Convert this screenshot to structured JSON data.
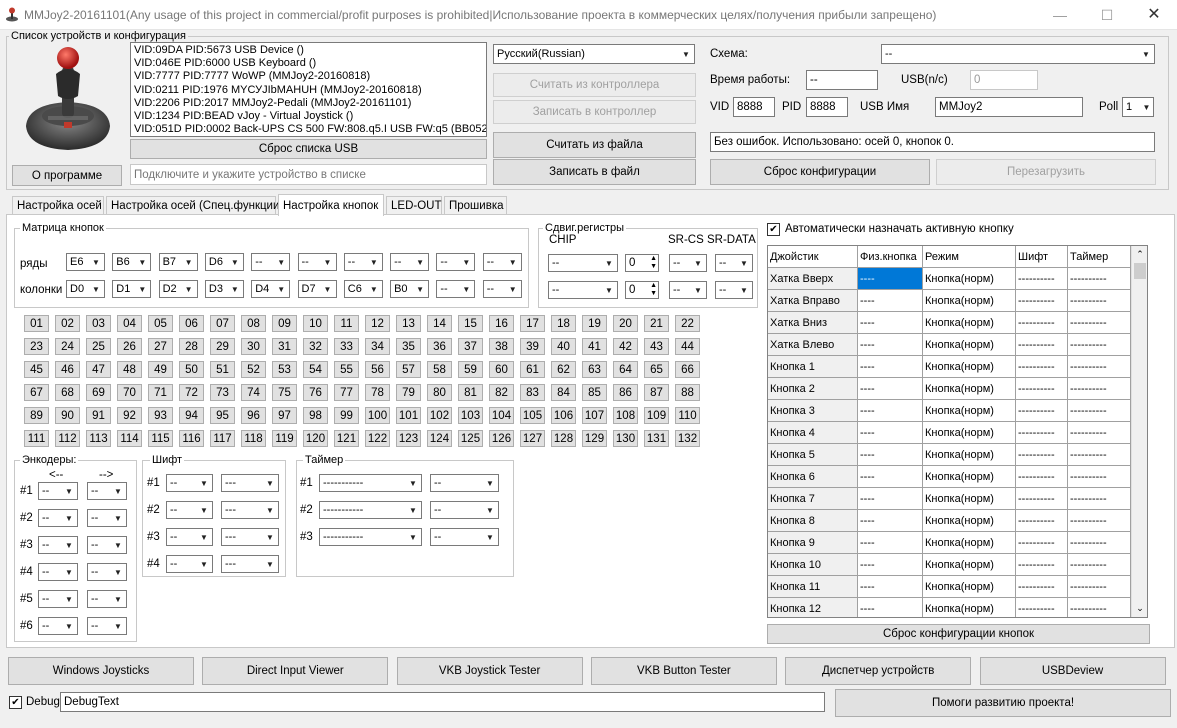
{
  "window": {
    "title": "MMJoy2-20161101(Any usage of this project in commercial/profit purposes is prohibited|Использование проекта в коммерческих целях/получения прибыли запрещено)"
  },
  "devices": {
    "group_label": "Список устройств и конфигурация",
    "list": [
      "VID:09DA PID:5673 USB Device ()",
      "VID:046E PID:6000 USB Keyboard ()",
      "VID:7777 PID:7777 WoWP (MMJoy2-20160818)",
      "VID:0211 PID:1976 MYСУJIbMAHUH (MMJoy2-20160818)",
      "VID:2206 PID:2017 MMJoy2-Pedali (MMJoy2-20161101)",
      "VID:1234 PID:BEAD vJoy - Virtual Joystick ()",
      "VID:051D PID:0002 Back-UPS CS 500 FW:808.q5.I USB FW:q5 (BB0520"
    ],
    "reset_usb": "Сброс списка USB",
    "about": "О программе",
    "hint": "Подключите и укажите устройство в списке"
  },
  "language": "Русский(Russian)",
  "controller": {
    "read": "Считать из контроллера",
    "write": "Записать в контроллер",
    "read_file": "Считать из файла",
    "write_file": "Записать в файл"
  },
  "scheme": {
    "label": "Схема:",
    "value": "--",
    "uptime_label": "Время работы:",
    "uptime_value": "--",
    "usb_label": "USB(n/c)",
    "usb_value": "0",
    "vid_label": "VID",
    "vid_value": "8888",
    "pid_label": "PID",
    "pid_value": "8888",
    "usbname_label": "USB Имя",
    "usbname_value": "MMJoy2",
    "poll_label": "Poll",
    "poll_value": "1",
    "status": "Без ошибок. Использовано: осей  0, кнопок  0.",
    "reset_config": "Сброс конфигурации",
    "reboot": "Перезагрузить"
  },
  "tabs": [
    "Настройка осей",
    "Настройка осей (Спец.функции)",
    "Настройка кнопок",
    "LED-OUT",
    "Прошивка"
  ],
  "matrix": {
    "label": "Матрица кнопок",
    "rows_label": "ряды",
    "cols_label": "колонки",
    "rows": [
      "E6",
      "B6",
      "B7",
      "D6",
      "--",
      "--",
      "--",
      "--",
      "--",
      "--"
    ],
    "cols": [
      "D0",
      "D1",
      "D2",
      "D3",
      "D4",
      "D7",
      "C6",
      "B0",
      "--",
      "--"
    ]
  },
  "shift_registers": {
    "label": "Сдвиг.регистры",
    "chip_label": "CHIP",
    "srcs_label": "SR-CS",
    "srdata_label": "SR-DATA",
    "rows": [
      {
        "chip": "--",
        "count": "0",
        "cs": "--",
        "data": "--"
      },
      {
        "chip": "--",
        "count": "0",
        "cs": "--",
        "data": "--"
      }
    ]
  },
  "buttons": [
    "01",
    "02",
    "03",
    "04",
    "05",
    "06",
    "07",
    "08",
    "09",
    "10",
    "11",
    "12",
    "13",
    "14",
    "15",
    "16",
    "17",
    "18",
    "19",
    "20",
    "21",
    "22",
    "23",
    "24",
    "25",
    "26",
    "27",
    "28",
    "29",
    "30",
    "31",
    "32",
    "33",
    "34",
    "35",
    "36",
    "37",
    "38",
    "39",
    "40",
    "41",
    "42",
    "43",
    "44",
    "45",
    "46",
    "47",
    "48",
    "49",
    "50",
    "51",
    "52",
    "53",
    "54",
    "55",
    "56",
    "57",
    "58",
    "59",
    "60",
    "61",
    "62",
    "63",
    "64",
    "65",
    "66",
    "67",
    "68",
    "69",
    "70",
    "71",
    "72",
    "73",
    "74",
    "75",
    "76",
    "77",
    "78",
    "79",
    "80",
    "81",
    "82",
    "83",
    "84",
    "85",
    "86",
    "87",
    "88",
    "89",
    "90",
    "91",
    "92",
    "93",
    "94",
    "95",
    "96",
    "97",
    "98",
    "99",
    "100",
    "101",
    "102",
    "103",
    "104",
    "105",
    "106",
    "107",
    "108",
    "109",
    "110",
    "111",
    "112",
    "113",
    "114",
    "115",
    "116",
    "117",
    "118",
    "119",
    "120",
    "121",
    "122",
    "123",
    "124",
    "125",
    "126",
    "127",
    "128",
    "129",
    "130",
    "131",
    "132"
  ],
  "encoders": {
    "label": "Энкодеры:",
    "left": "<--",
    "right": "-->",
    "rows": [
      {
        "n": "#1",
        "a": "--",
        "b": "--"
      },
      {
        "n": "#2",
        "a": "--",
        "b": "--"
      },
      {
        "n": "#3",
        "a": "--",
        "b": "--"
      },
      {
        "n": "#4",
        "a": "--",
        "b": "--"
      },
      {
        "n": "#5",
        "a": "--",
        "b": "--"
      },
      {
        "n": "#6",
        "a": "--",
        "b": "--"
      }
    ]
  },
  "shift": {
    "label": "Шифт",
    "rows": [
      {
        "n": "#1",
        "a": "--",
        "b": "---"
      },
      {
        "n": "#2",
        "a": "--",
        "b": "---"
      },
      {
        "n": "#3",
        "a": "--",
        "b": "---"
      },
      {
        "n": "#4",
        "a": "--",
        "b": "---"
      }
    ]
  },
  "timer": {
    "label": "Таймер",
    "rows": [
      {
        "n": "#1",
        "a": "-----------",
        "b": "--"
      },
      {
        "n": "#2",
        "a": "-----------",
        "b": "--"
      },
      {
        "n": "#3",
        "a": "-----------",
        "b": "--"
      }
    ]
  },
  "auto_assign": {
    "label": "Автоматически назначать активную кнопку",
    "checked": "✔"
  },
  "grid": {
    "headers": [
      "Джойстик",
      "Физ.кнопка",
      "Режим",
      "Шифт",
      "Таймер"
    ],
    "rows": [
      [
        "Хатка Вверх",
        "----",
        "Кнопка(норм)",
        "----------",
        "----------"
      ],
      [
        "Хатка Вправо",
        "----",
        "Кнопка(норм)",
        "----------",
        "----------"
      ],
      [
        "Хатка Вниз",
        "----",
        "Кнопка(норм)",
        "----------",
        "----------"
      ],
      [
        "Хатка Влево",
        "----",
        "Кнопка(норм)",
        "----------",
        "----------"
      ],
      [
        "Кнопка 1",
        "----",
        "Кнопка(норм)",
        "----------",
        "----------"
      ],
      [
        "Кнопка 2",
        "----",
        "Кнопка(норм)",
        "----------",
        "----------"
      ],
      [
        "Кнопка 3",
        "----",
        "Кнопка(норм)",
        "----------",
        "----------"
      ],
      [
        "Кнопка 4",
        "----",
        "Кнопка(норм)",
        "----------",
        "----------"
      ],
      [
        "Кнопка 5",
        "----",
        "Кнопка(норм)",
        "----------",
        "----------"
      ],
      [
        "Кнопка 6",
        "----",
        "Кнопка(норм)",
        "----------",
        "----------"
      ],
      [
        "Кнопка 7",
        "----",
        "Кнопка(норм)",
        "----------",
        "----------"
      ],
      [
        "Кнопка 8",
        "----",
        "Кнопка(норм)",
        "----------",
        "----------"
      ],
      [
        "Кнопка 9",
        "----",
        "Кнопка(норм)",
        "----------",
        "----------"
      ],
      [
        "Кнопка 10",
        "----",
        "Кнопка(норм)",
        "----------",
        "----------"
      ],
      [
        "Кнопка 11",
        "----",
        "Кнопка(норм)",
        "----------",
        "----------"
      ],
      [
        "Кнопка 12",
        "----",
        "Кнопка(норм)",
        "----------",
        "----------"
      ]
    ],
    "reset": "Сброс конфигурации кнопок"
  },
  "bottom": [
    "Windows Joysticks",
    "Direct Input Viewer",
    "VKB Joystick Tester",
    "VKB Button Tester",
    "Диспетчер устройств",
    "USBDeview"
  ],
  "debug": {
    "label": "Debug",
    "value": "DebugText",
    "checked": "✔"
  },
  "help": "Помоги развитию проекта!",
  "colors": {
    "selection": "#0078d7",
    "button_face": "#e1e1e1",
    "window": "#f0f0f0"
  }
}
